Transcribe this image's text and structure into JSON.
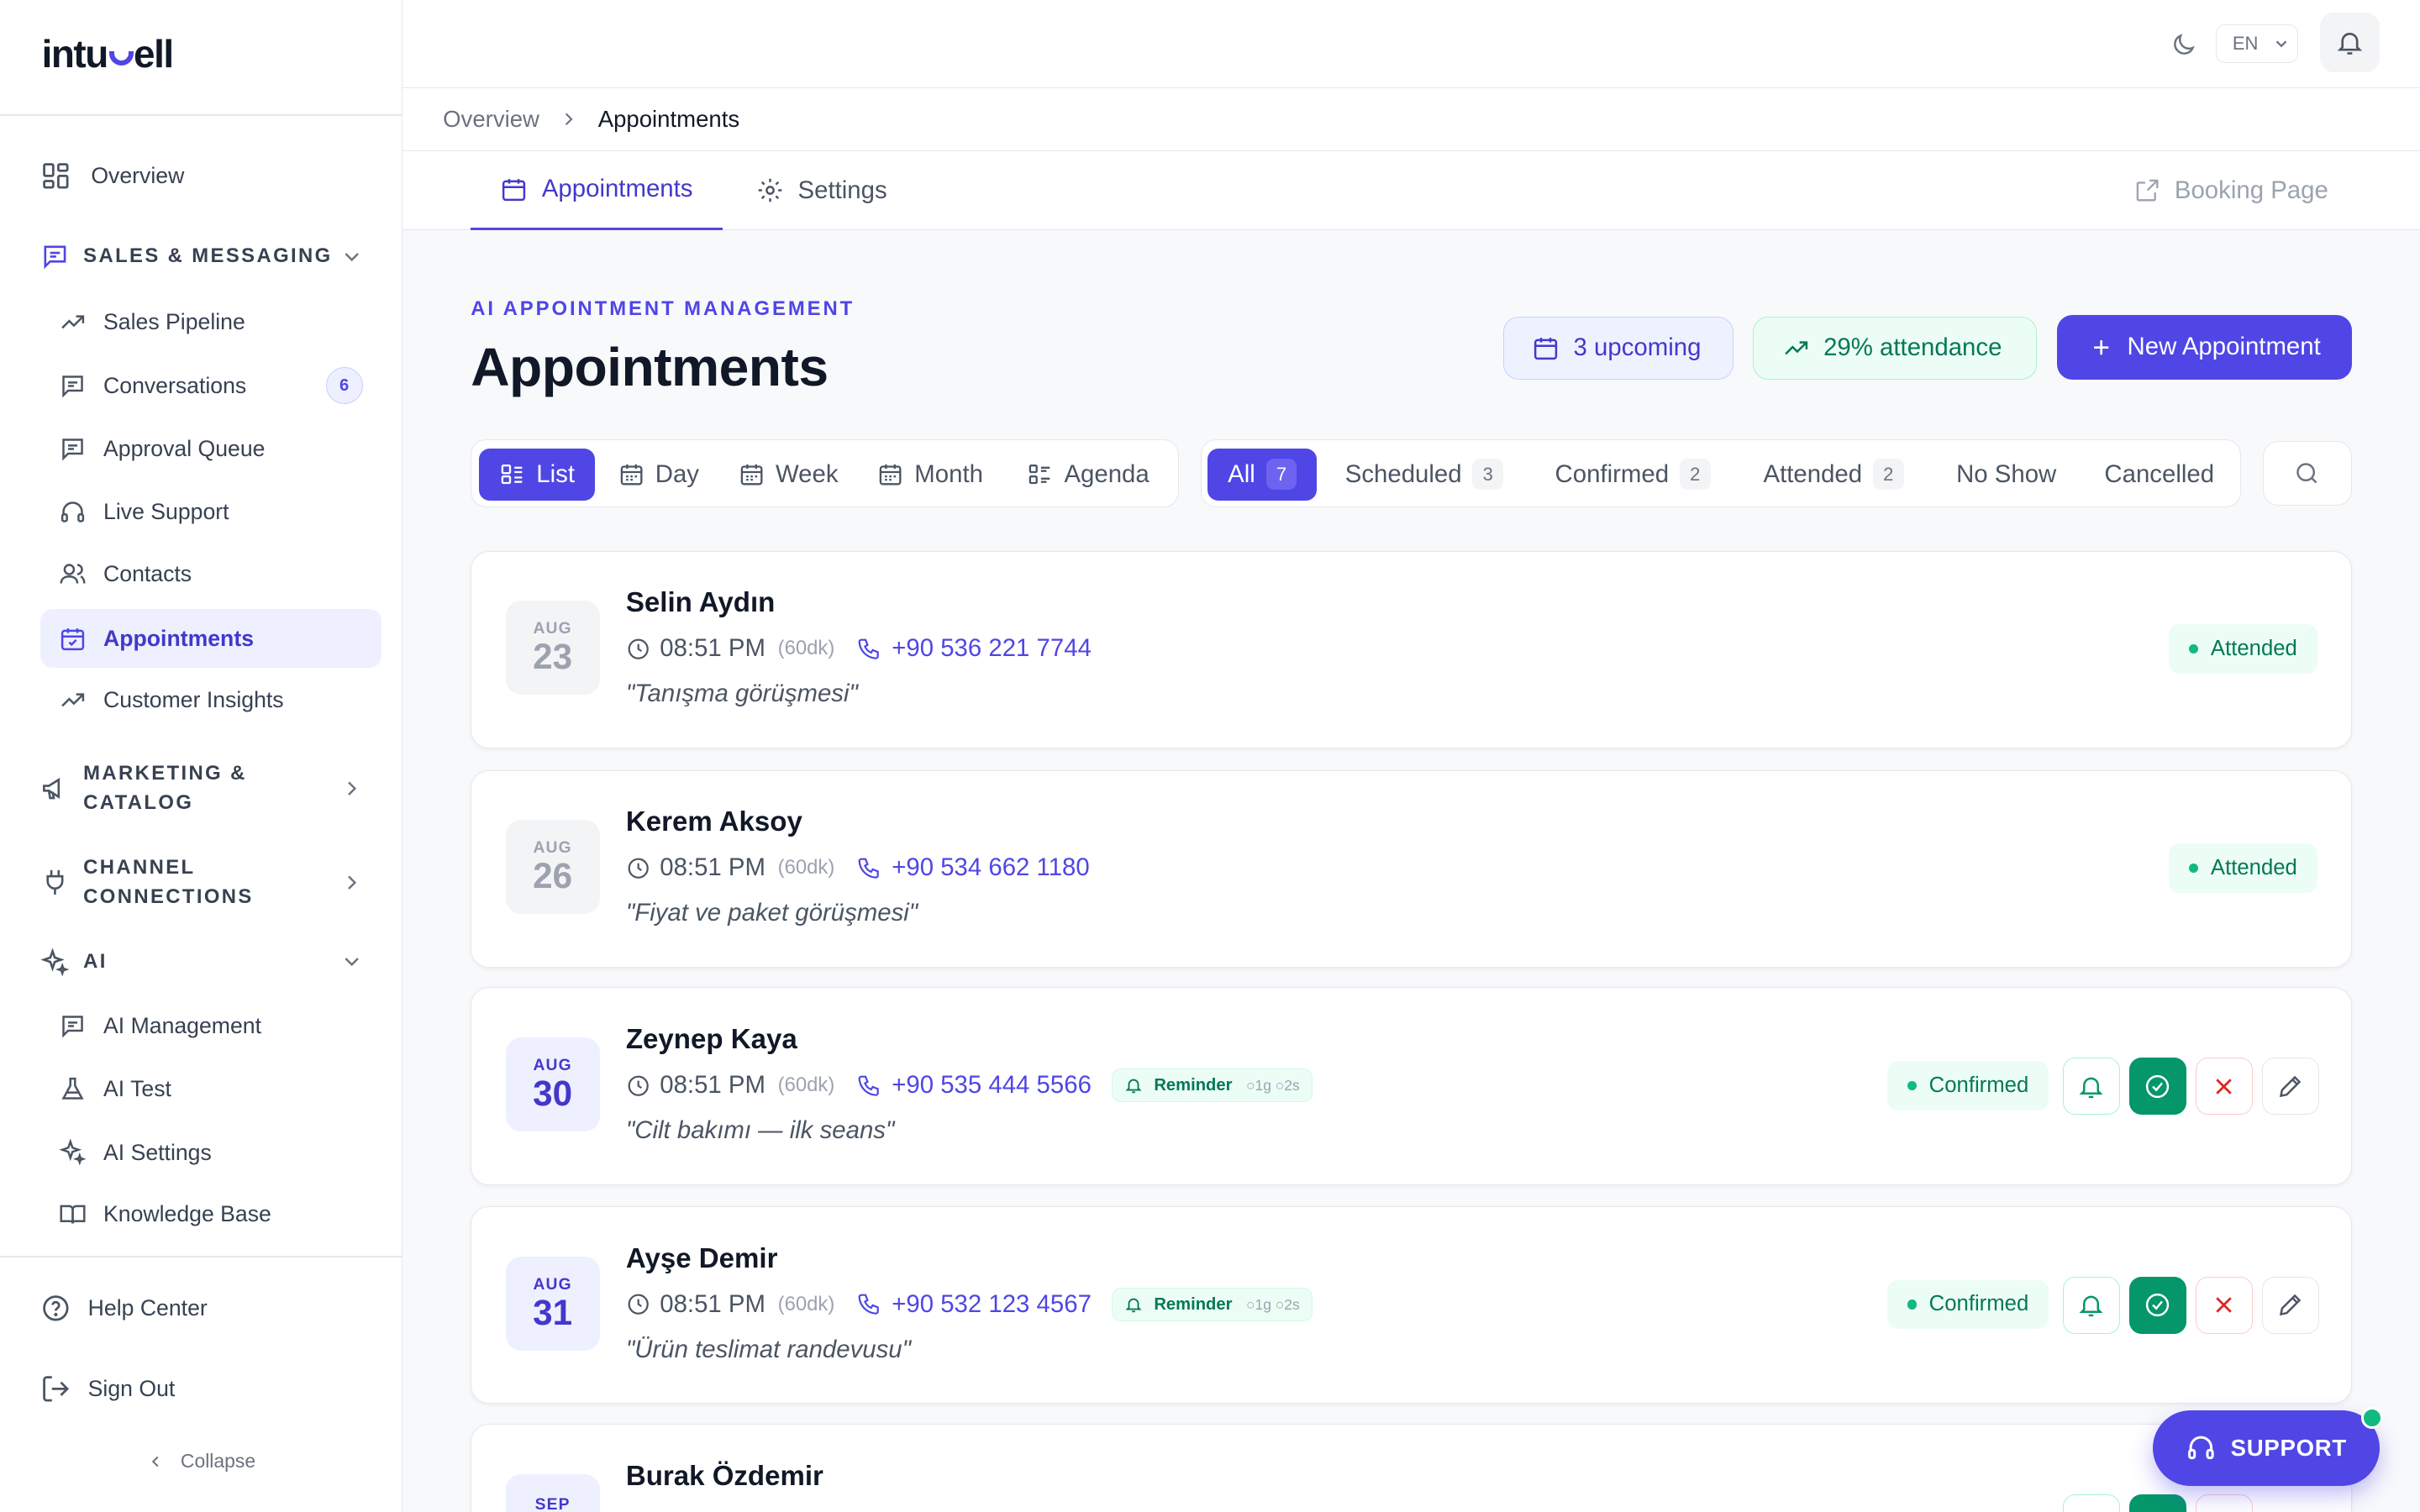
{
  "app": {
    "logo": "intusell"
  },
  "topbar": {
    "language": "EN"
  },
  "sidebar": {
    "overview": "Overview",
    "sections": [
      {
        "label": "SALES & MESSAGING"
      },
      {
        "label": "MARKETING & CATALOG"
      },
      {
        "label": "CHANNEL CONNECTIONS"
      },
      {
        "label": "AI"
      }
    ],
    "sales_items": [
      {
        "label": "Sales Pipeline"
      },
      {
        "label": "Conversations",
        "badge": "6"
      },
      {
        "label": "Approval Queue"
      },
      {
        "label": "Live Support"
      },
      {
        "label": "Contacts"
      },
      {
        "label": "Appointments"
      },
      {
        "label": "Customer Insights"
      }
    ],
    "ai_items": [
      {
        "label": "AI Management"
      },
      {
        "label": "AI Test"
      },
      {
        "label": "AI Settings"
      },
      {
        "label": "Knowledge Base"
      }
    ],
    "help": "Help Center",
    "signout": "Sign Out",
    "collapse": "Collapse"
  },
  "breadcrumb": {
    "parent": "Overview",
    "current": "Appointments"
  },
  "tabs": [
    {
      "label": "Appointments"
    },
    {
      "label": "Settings"
    }
  ],
  "booking_page": "Booking Page",
  "header": {
    "eyebrow": "AI APPOINTMENT MANAGEMENT",
    "title": "Appointments",
    "upcoming": "3 upcoming",
    "attendance": "29% attendance",
    "new_button": "New Appointment"
  },
  "views": [
    {
      "label": "List"
    },
    {
      "label": "Day"
    },
    {
      "label": "Week"
    },
    {
      "label": "Month"
    },
    {
      "label": "Agenda"
    }
  ],
  "filters": [
    {
      "label": "All",
      "count": "7"
    },
    {
      "label": "Scheduled",
      "count": "3"
    },
    {
      "label": "Confirmed",
      "count": "2"
    },
    {
      "label": "Attended",
      "count": "2"
    },
    {
      "label": "No Show"
    },
    {
      "label": "Cancelled"
    }
  ],
  "appointments": [
    {
      "month": "AUG",
      "day": "23",
      "name": "Selin Aydın",
      "time": "08:51 PM",
      "duration": "(60dk)",
      "phone": "+90 536 221 7744",
      "note": "\"Tanışma görüşmesi\"",
      "status": "Attended"
    },
    {
      "month": "AUG",
      "day": "26",
      "name": "Kerem Aksoy",
      "time": "08:51 PM",
      "duration": "(60dk)",
      "phone": "+90 534 662 1180",
      "note": "\"Fiyat ve paket görüşmesi\"",
      "status": "Attended"
    },
    {
      "month": "AUG",
      "day": "30",
      "name": "Zeynep Kaya",
      "time": "08:51 PM",
      "duration": "(60dk)",
      "phone": "+90 535 444 5566",
      "reminder": "Reminder",
      "reminder_times": "○1g ○2s",
      "note": "\"Cilt bakımı — ilk seans\"",
      "status": "Confirmed"
    },
    {
      "month": "AUG",
      "day": "31",
      "name": "Ayşe Demir",
      "time": "08:51 PM",
      "duration": "(60dk)",
      "phone": "+90 532 123 4567",
      "reminder": "Reminder",
      "reminder_times": "○1g ○2s",
      "note": "\"Ürün teslimat randevusu\"",
      "status": "Confirmed"
    },
    {
      "month": "SEP",
      "name": "Burak Özdemir"
    }
  ],
  "support_button": "SUPPORT",
  "colors": {
    "accent": "#4f46e5",
    "success": "#059669",
    "danger": "#dc2626"
  }
}
